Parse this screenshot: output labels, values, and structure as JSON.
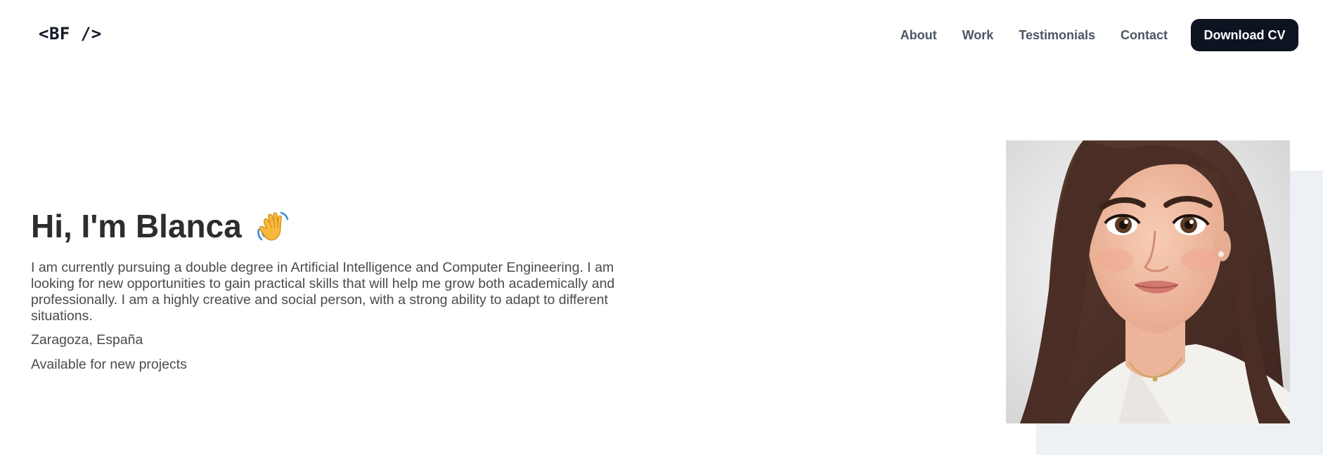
{
  "header": {
    "logo": "<BF />",
    "nav": {
      "about": "About",
      "work": "Work",
      "testimonials": "Testimonials",
      "contact": "Contact"
    },
    "cta_label": "Download CV"
  },
  "hero": {
    "title": "Hi, I'm Blanca",
    "title_icon": "waving-hand-icon",
    "bio": "I am currently pursuing a double degree in Artificial Intelligence and Computer Engineering. I am looking for new opportunities to gain practical skills that will help me grow both academically and professionally. I am a highly creative and social person, with a strong ability to adapt to different situations.",
    "location": "Zaragoza, España",
    "availability": "Available for new projects"
  },
  "portrait": {
    "icon": "avatar-portrait"
  },
  "colors": {
    "cta_bg": "#0d1320",
    "nav_text": "#4b5563",
    "title_text": "#2d2d2d",
    "body_text": "#4b4b4b",
    "portrait_backdrop": "#edf0f5"
  }
}
